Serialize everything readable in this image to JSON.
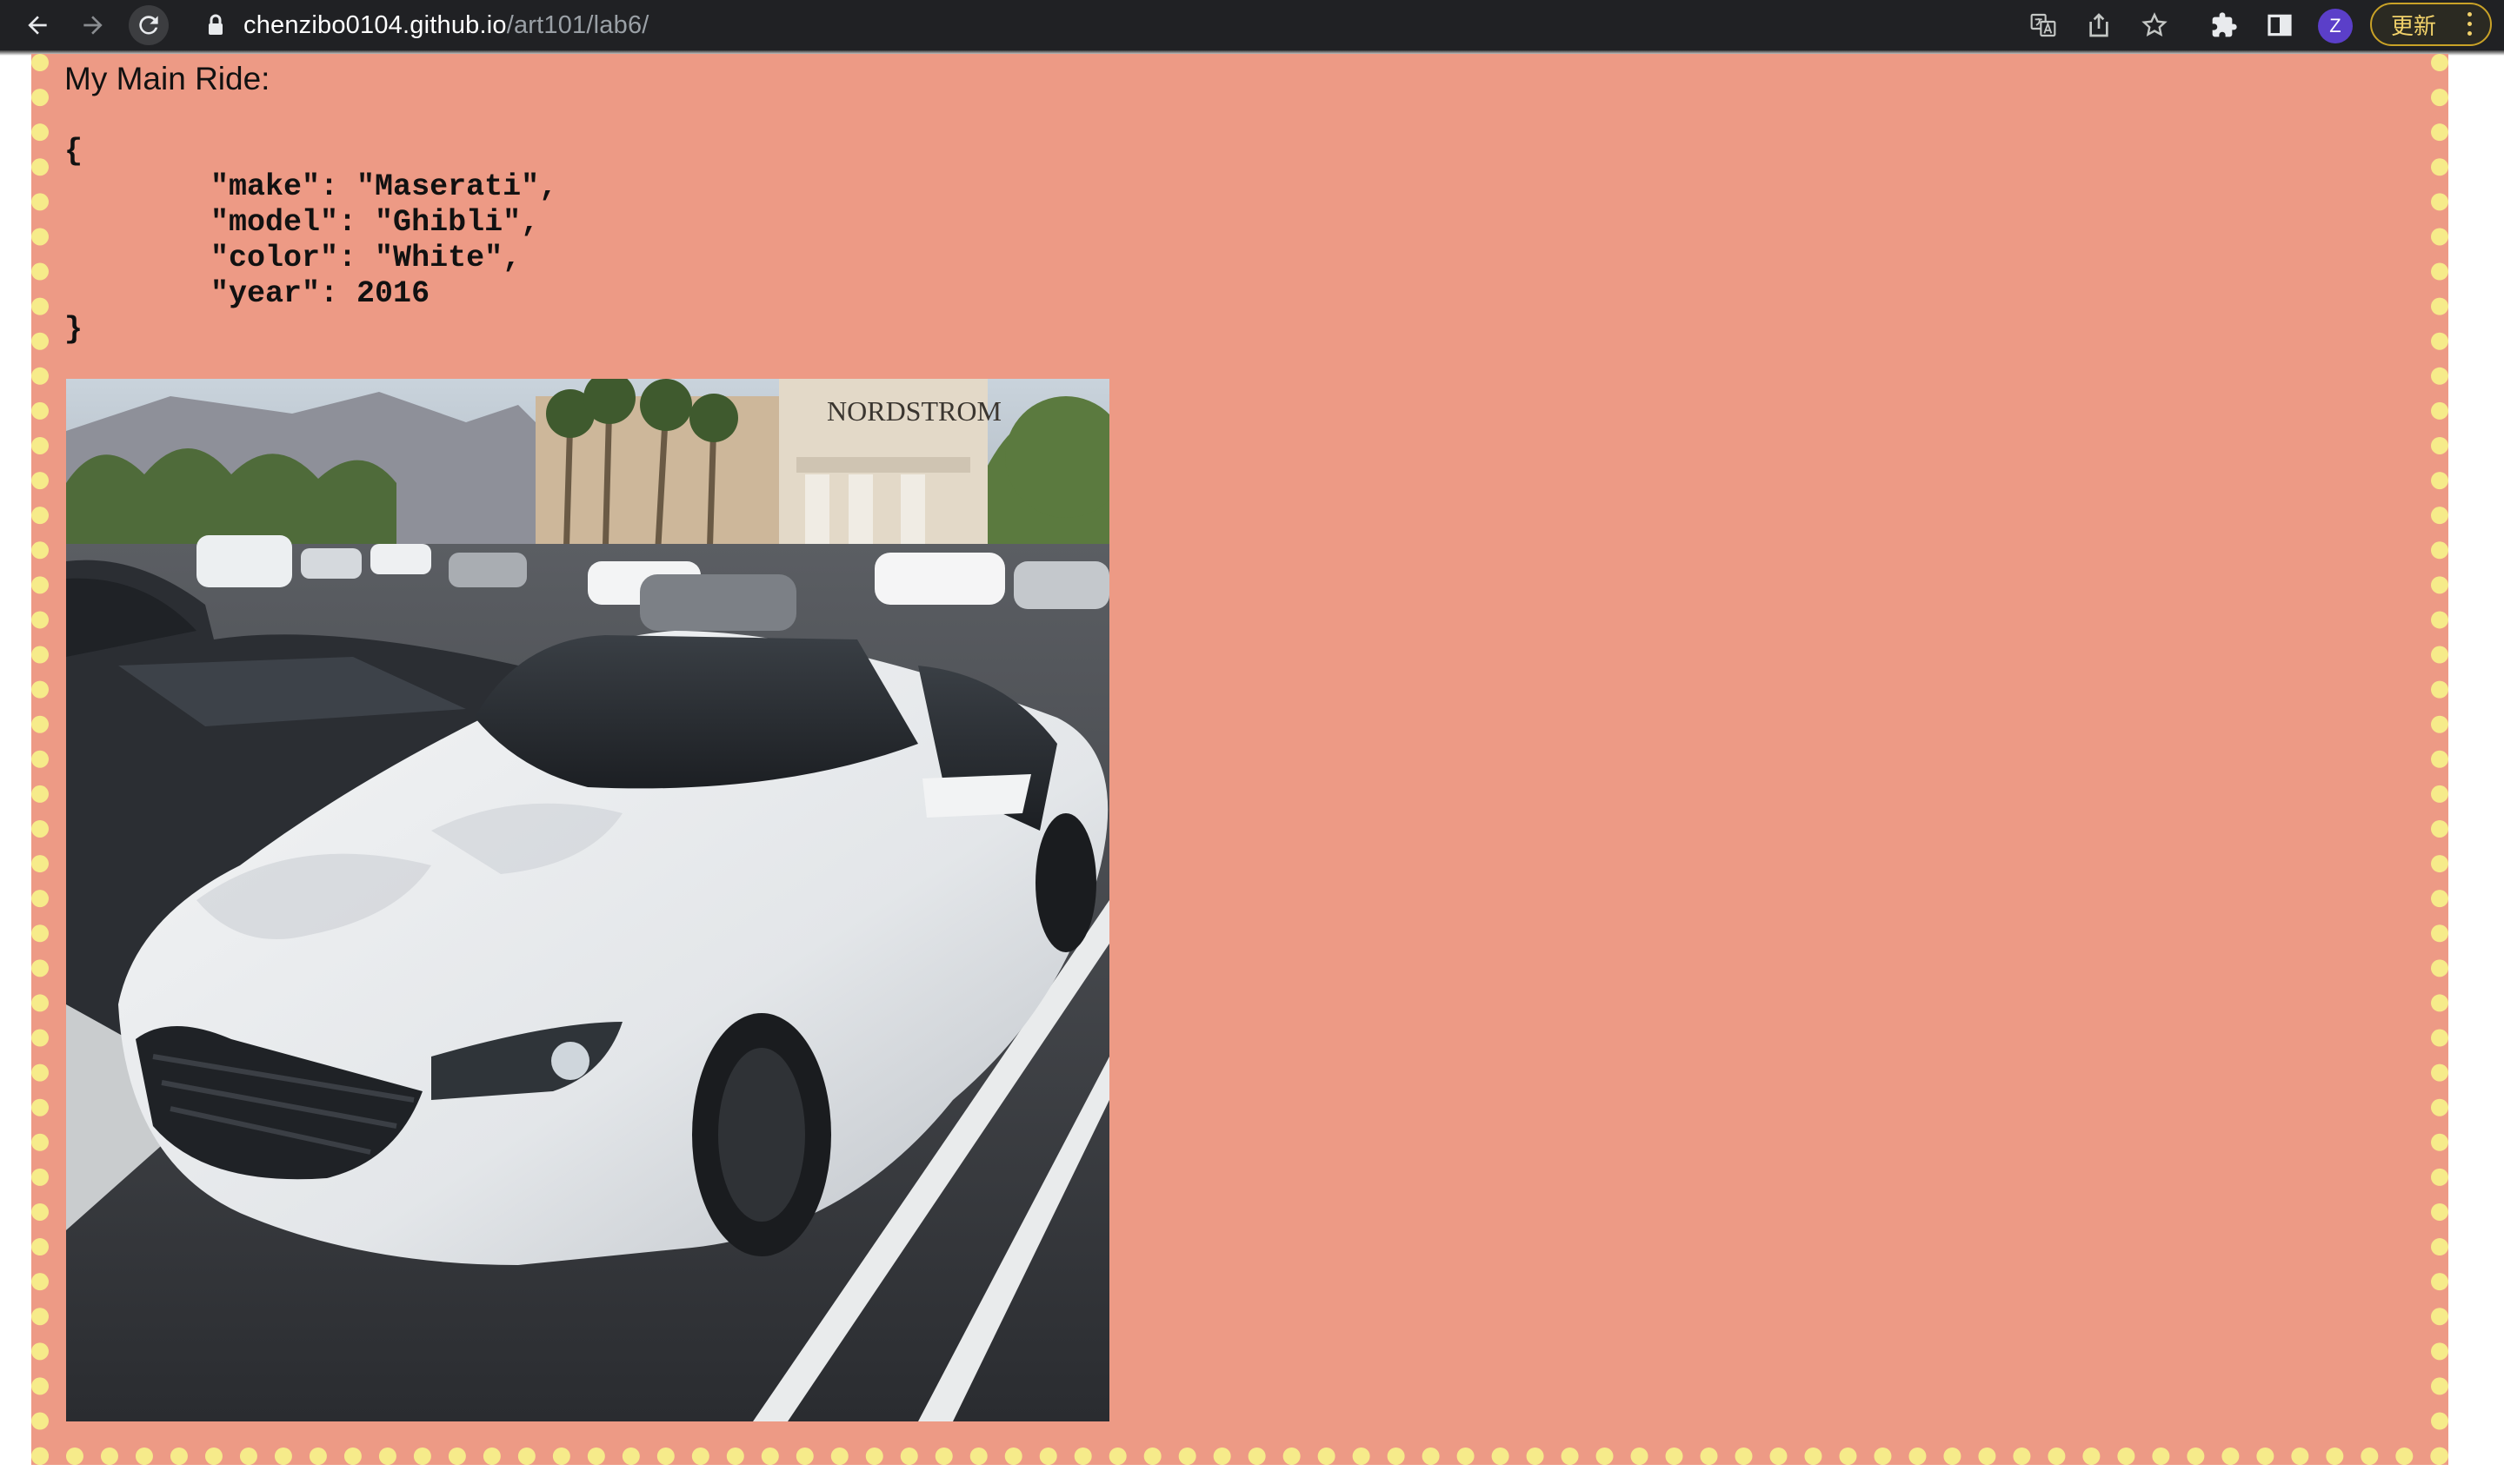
{
  "browser": {
    "url_host": "chenzibo0104.github.io",
    "url_path": "/art101/lab6/",
    "profile_initial": "Z",
    "update_label": "更新",
    "icons": [
      "back-arrow-icon",
      "forward-arrow-icon",
      "reload-icon",
      "lock-icon",
      "translate-icon",
      "share-icon",
      "star-icon",
      "extensions-icon",
      "side-panel-icon",
      "kebab-menu-icon"
    ]
  },
  "page": {
    "title": "My Main Ride:",
    "json_lines": [
      "{",
      "        \"make\": \"Maserati\",",
      "        \"model\": \"Ghibli\",",
      "        \"color\": \"White\",",
      "        \"year\": 2016",
      "}"
    ],
    "photo": {
      "storefront_sign": "NORDSTROM"
    },
    "colors": {
      "background": "#ed9a85",
      "border_dots": "#f6eb8a"
    }
  }
}
